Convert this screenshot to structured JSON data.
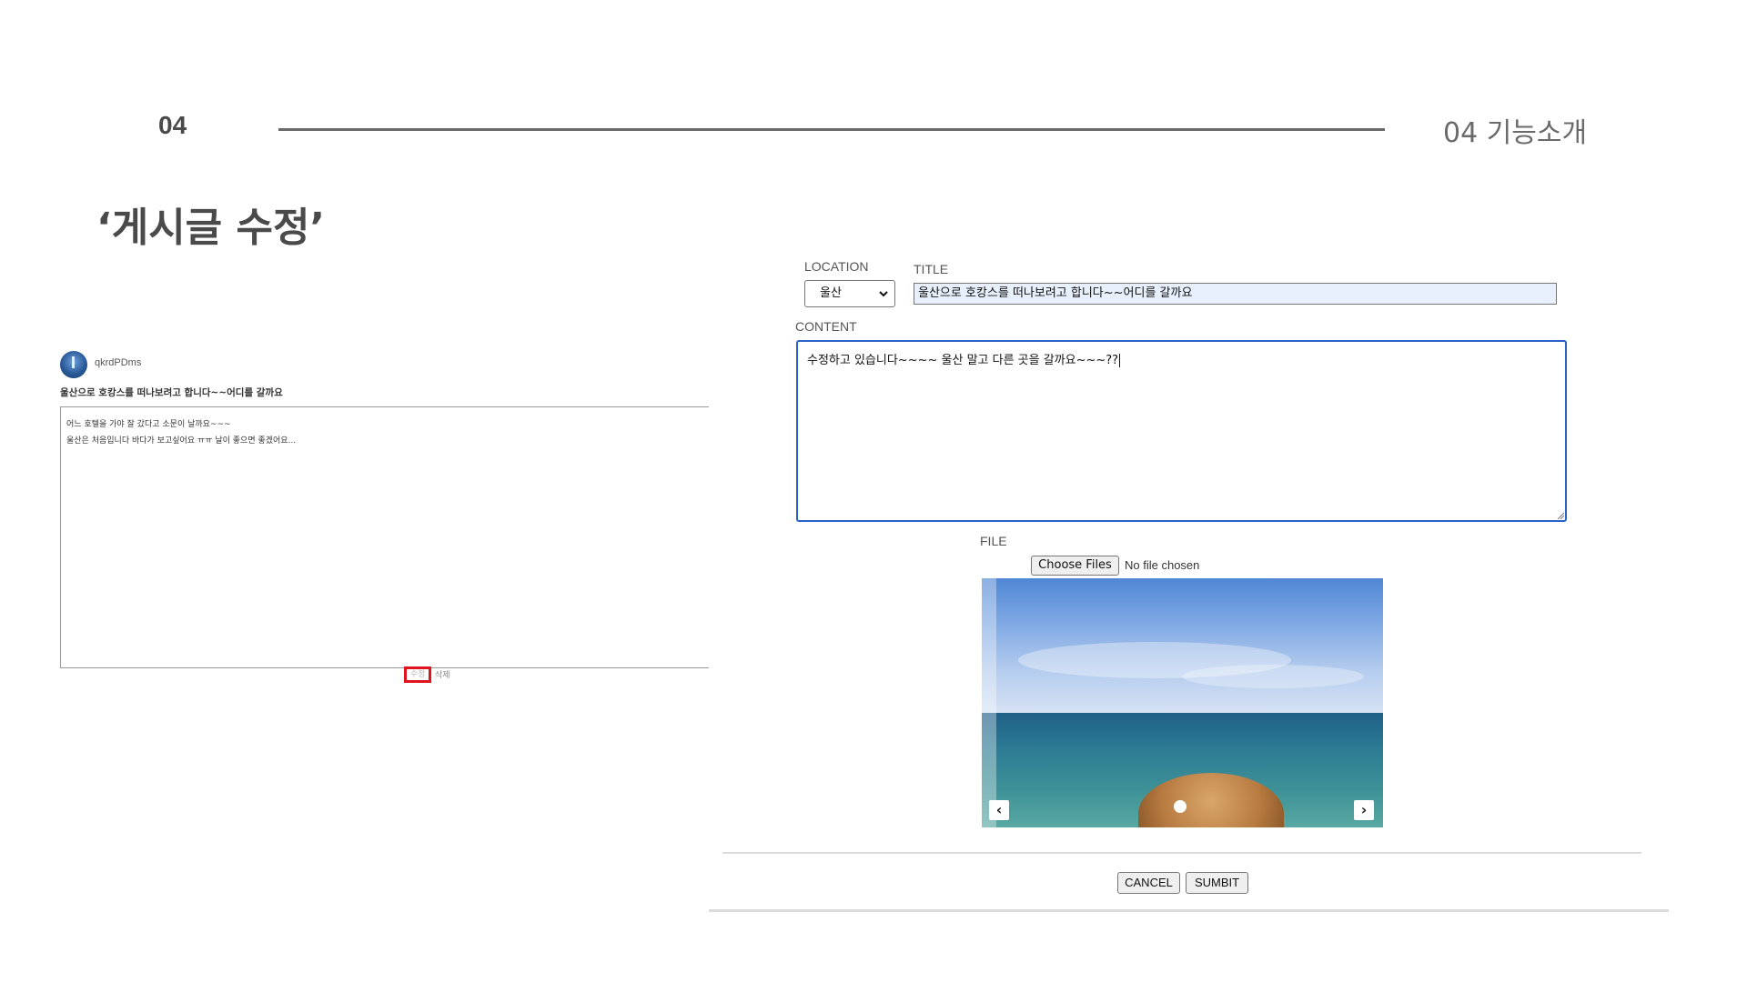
{
  "slide": {
    "number": "04",
    "section_label": "04  기능소개",
    "title": "‘게시글 수정’"
  },
  "post": {
    "username": "qkrdPDms",
    "title": "울산으로 호캉스를 떠나보려고 합니다~~어디를 갈까요",
    "content_lines": [
      "어느 호텔을 가야 잘 갔다고 소문이 날까요~~~",
      "울산은 처음입니다 바다가 보고싶어요 ㅠㅠ 날이 좋으면 좋겠어요..."
    ],
    "edit_label": "수정",
    "delete_label": "삭제"
  },
  "form": {
    "location_label": "LOCATION",
    "location_value": "울산",
    "title_label": "TITLE",
    "title_value": "울산으로 호캉스를 떠나보려고 합니다~~어디를 갈까요",
    "content_label": "CONTENT",
    "content_value": "수정하고 있습니다~~~~ 울산 말고 다른 곳을 갈까요~~~??",
    "file_label": "FILE",
    "choose_files_label": "Choose Files",
    "file_status": "No file chosen",
    "cancel_label": "CANCEL",
    "submit_label": "SUMBIT"
  },
  "colors": {
    "highlight_border": "#e0141e",
    "focus_border": "#2a62c8",
    "autofill_bg": "#e8f0fe"
  }
}
